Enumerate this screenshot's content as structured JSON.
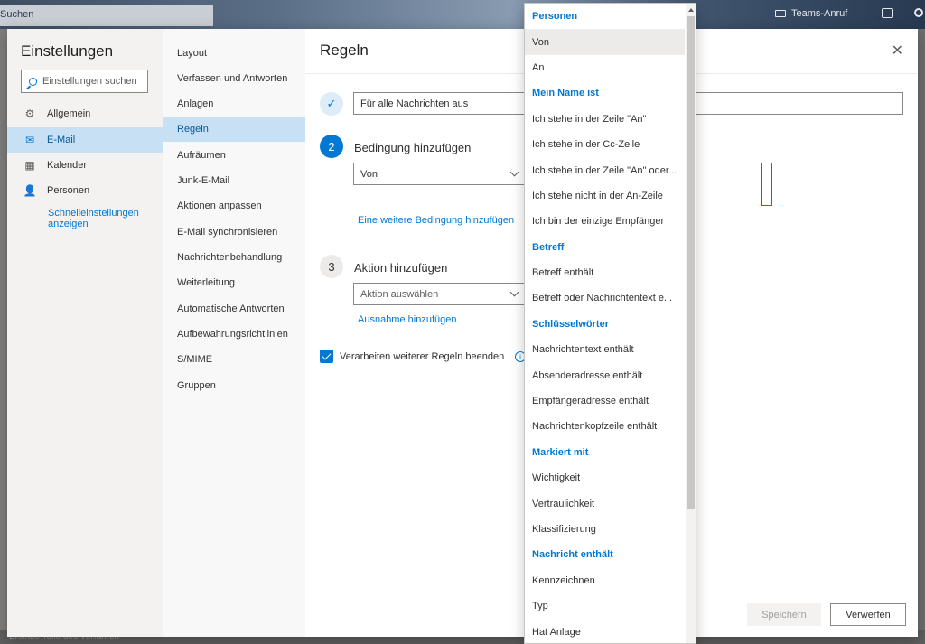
{
  "background": {
    "search_label": "Suchen",
    "teams_call": "Teams-Anruf",
    "bottom_text": "Ersetze Teile des Verfahren"
  },
  "settings": {
    "title": "Einstellungen",
    "search_placeholder": "Einstellungen suchen",
    "categories": [
      {
        "label": "Allgemein",
        "icon": "gear-icon"
      },
      {
        "label": "E-Mail",
        "icon": "mail-icon"
      },
      {
        "label": "Kalender",
        "icon": "calendar-icon"
      },
      {
        "label": "Personen",
        "icon": "people-icon"
      }
    ],
    "quick_settings": "Schnelleinstellungen anzeigen"
  },
  "mail_subnav": {
    "items": [
      "Layout",
      "Verfassen und Antworten",
      "Anlagen",
      "Regeln",
      "Aufräumen",
      "Junk-E-Mail",
      "Aktionen anpassen",
      "E-Mail synchronisieren",
      "Nachrichtenbehandlung",
      "Weiterleitung",
      "Automatische Antworten",
      "Aufbewahrungsrichtlinien",
      "S/MIME",
      "Gruppen"
    ],
    "active": "Regeln"
  },
  "rules": {
    "title": "Regeln",
    "step1_value": "Für alle Nachrichten aus",
    "step2_number": "2",
    "step2_label": "Bedingung hinzufügen",
    "condition_value": "Von",
    "add_condition_link": "Eine weitere Bedingung hinzufügen",
    "step3_number": "3",
    "step3_label": "Aktion hinzufügen",
    "action_placeholder": "Aktion auswählen",
    "add_exception_link": "Ausnahme hinzufügen",
    "stop_processing_label": "Verarbeiten weiterer Regeln beenden",
    "stop_processing_checked": true,
    "save_button": "Speichern",
    "discard_button": "Verwerfen"
  },
  "dropdown": {
    "selected": "Von",
    "items": [
      {
        "label": "Personen",
        "header": true
      },
      {
        "label": "Von",
        "header": false
      },
      {
        "label": "An",
        "header": false
      },
      {
        "label": "Mein Name ist",
        "header": true
      },
      {
        "label": "Ich stehe in der Zeile \"An\"",
        "header": false
      },
      {
        "label": "Ich stehe in der Cc-Zeile",
        "header": false
      },
      {
        "label": "Ich stehe in der Zeile \"An\" oder...",
        "header": false
      },
      {
        "label": "Ich stehe nicht in der An-Zeile",
        "header": false
      },
      {
        "label": "Ich bin der einzige Empfänger",
        "header": false
      },
      {
        "label": "Betreff",
        "header": true
      },
      {
        "label": "Betreff enthält",
        "header": false
      },
      {
        "label": "Betreff oder Nachrichtentext e...",
        "header": false
      },
      {
        "label": "Schlüsselwörter",
        "header": true
      },
      {
        "label": "Nachrichtentext enthält",
        "header": false
      },
      {
        "label": "Absenderadresse enthält",
        "header": false
      },
      {
        "label": "Empfängeradresse enthält",
        "header": false
      },
      {
        "label": "Nachrichtenkopfzeile enthält",
        "header": false
      },
      {
        "label": "Markiert mit",
        "header": true
      },
      {
        "label": "Wichtigkeit",
        "header": false
      },
      {
        "label": "Vertraulichkeit",
        "header": false
      },
      {
        "label": "Klassifizierung",
        "header": false
      },
      {
        "label": "Nachricht enthält",
        "header": true
      },
      {
        "label": "Kennzeichnen",
        "header": false
      },
      {
        "label": "Typ",
        "header": false
      },
      {
        "label": "Hat Anlage",
        "header": false
      }
    ]
  }
}
